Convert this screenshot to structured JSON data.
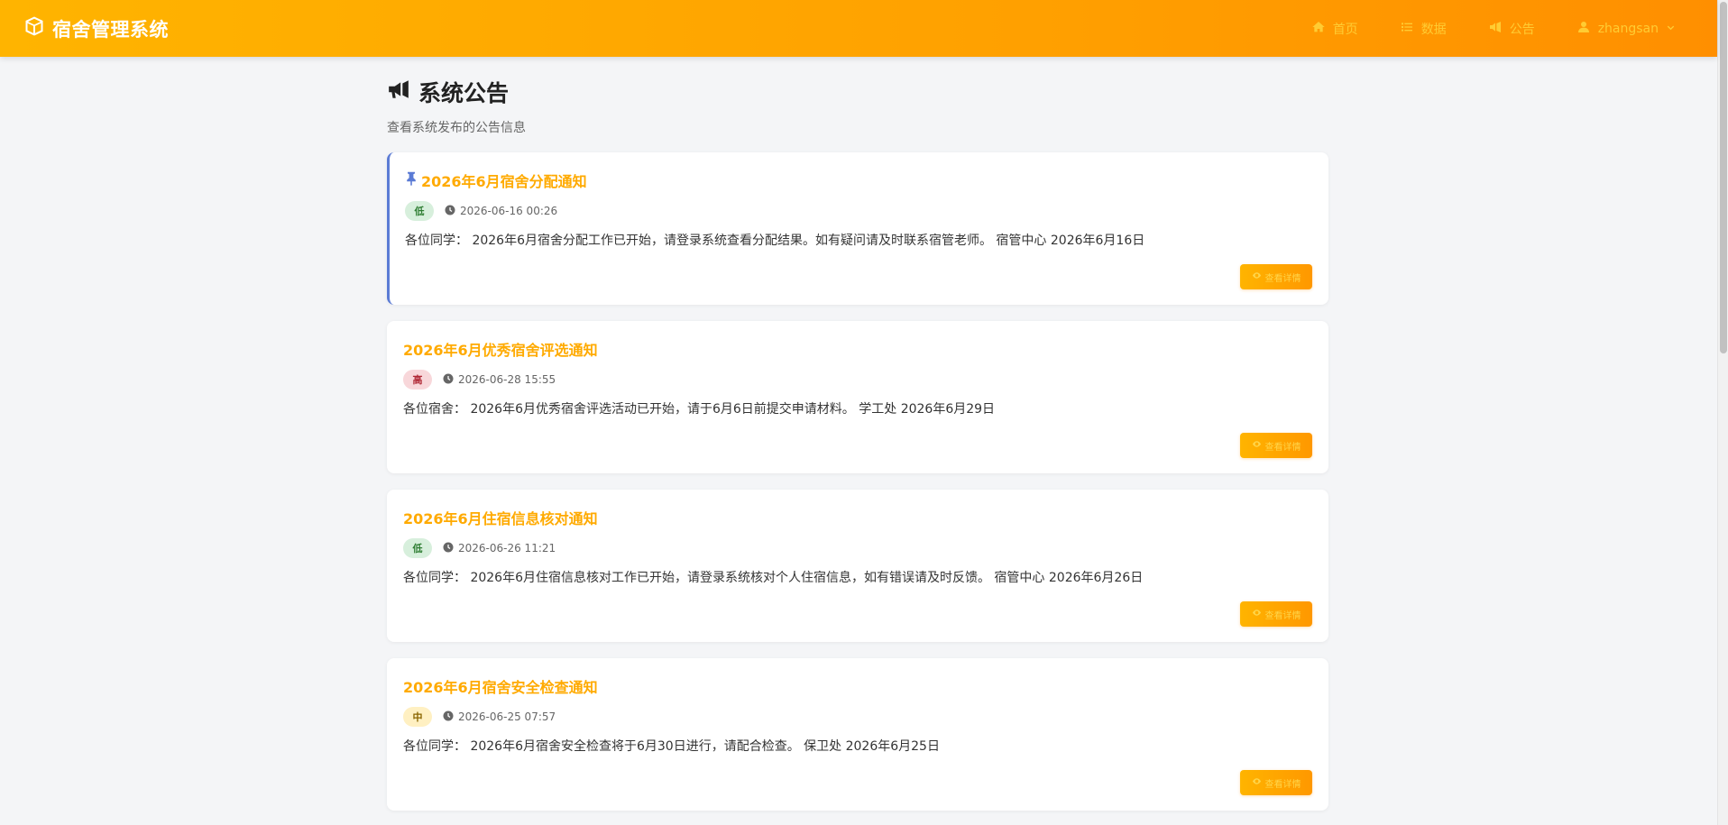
{
  "navbar": {
    "brand": "宿舍管理系统",
    "links": [
      {
        "label": "首页",
        "icon": "home-icon"
      },
      {
        "label": "数据",
        "icon": "list-icon"
      },
      {
        "label": "公告",
        "icon": "megaphone-icon"
      },
      {
        "label": "zhangsan",
        "icon": "user-icon"
      }
    ]
  },
  "page": {
    "title": "系统公告",
    "subtitle": "查看系统发布的公告信息"
  },
  "announcements": [
    {
      "title": "2026年6月宿舍分配通知",
      "pinned": true,
      "priority": "低",
      "time": "2026-06-16 00:26",
      "content": "各位同学： 2026年6月宿舍分配工作已开始，请登录系统查看分配结果。如有疑问请及时联系宿管老师。 宿管中心 2026年6月16日",
      "button": "查看详情"
    },
    {
      "title": "2026年6月优秀宿舍评选通知",
      "pinned": false,
      "priority": "高",
      "time": "2026-06-28 15:55",
      "content": "各位宿舍： 2026年6月优秀宿舍评选活动已开始，请于6月6日前提交申请材料。 学工处 2026年6月29日",
      "button": "查看详情"
    },
    {
      "title": "2026年6月住宿信息核对通知",
      "pinned": false,
      "priority": "低",
      "time": "2026-06-26 11:21",
      "content": "各位同学： 2026年6月住宿信息核对工作已开始，请登录系统核对个人住宿信息，如有错误请及时反馈。 宿管中心 2026年6月26日",
      "button": "查看详情"
    },
    {
      "title": "2026年6月宿舍安全检查通知",
      "pinned": false,
      "priority": "中",
      "time": "2026-06-25 07:57",
      "content": "各位同学： 2026年6月宿舍安全检查将于6月30日进行，请配合检查。 保卫处 2026年6月25日",
      "button": "查看详情"
    }
  ],
  "colors": {
    "accent": "#ffaa00",
    "nav_gradient_start": "#ffb400",
    "nav_gradient_end": "#ff8f00",
    "pinned_border": "#5b7bd5",
    "priority_low_bg": "#d7efdc",
    "priority_high_bg": "#f8d7da",
    "priority_mid_bg": "#fff0c2"
  }
}
